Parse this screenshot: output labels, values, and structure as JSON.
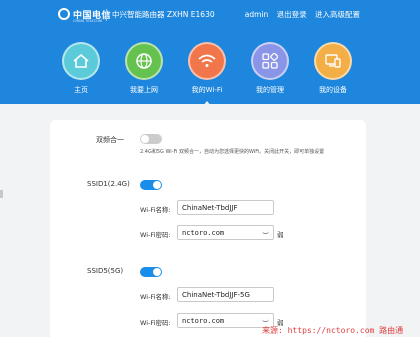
{
  "header": {
    "logo_cn": "中国电信",
    "logo_en": "CHINA TELECOM",
    "router_title": "中兴智能路由器 ZXHN E1630",
    "user": "admin",
    "logout": "退出登录",
    "advanced": "进入高级配置",
    "bg_color": "#1e86dc"
  },
  "nav": [
    {
      "label": "主页",
      "icon": "home-icon",
      "color": "#5ccbd9"
    },
    {
      "label": "我要上网",
      "icon": "globe-icon",
      "color": "#66c24f"
    },
    {
      "label": "我的Wi-Fi",
      "icon": "wifi-icon",
      "color": "#f1764b",
      "active": true
    },
    {
      "label": "我的管理",
      "icon": "grid-icon",
      "color": "#8a95e8"
    },
    {
      "label": "我的设备",
      "icon": "devices-icon",
      "color": "#f3ae45"
    }
  ],
  "wifi": {
    "dual_band_label": "双频合一",
    "dual_band_desc": "2.4G和5G Wi-Fi 双频合一，自动为您选择更快的WiFi。关闭此开关，即可单独设置",
    "ssid24": {
      "label": "SSID1(2.4G)",
      "name_label": "Wi-Fi名称:",
      "name_value": "ChinaNet-TbdJJF",
      "pwd_label": "Wi-Fi密码:",
      "pwd_value": "nctoro.com",
      "strength": "弱"
    },
    "ssid5": {
      "label": "SSID5(5G)",
      "name_label": "Wi-Fi名称:",
      "name_value": "ChinaNet-TbdJJF-5G",
      "pwd_label": "Wi-Fi密码:",
      "pwd_value": "nctoro.com",
      "strength": "弱"
    }
  },
  "watermark": "来源: https://nctoro.com 路由通"
}
